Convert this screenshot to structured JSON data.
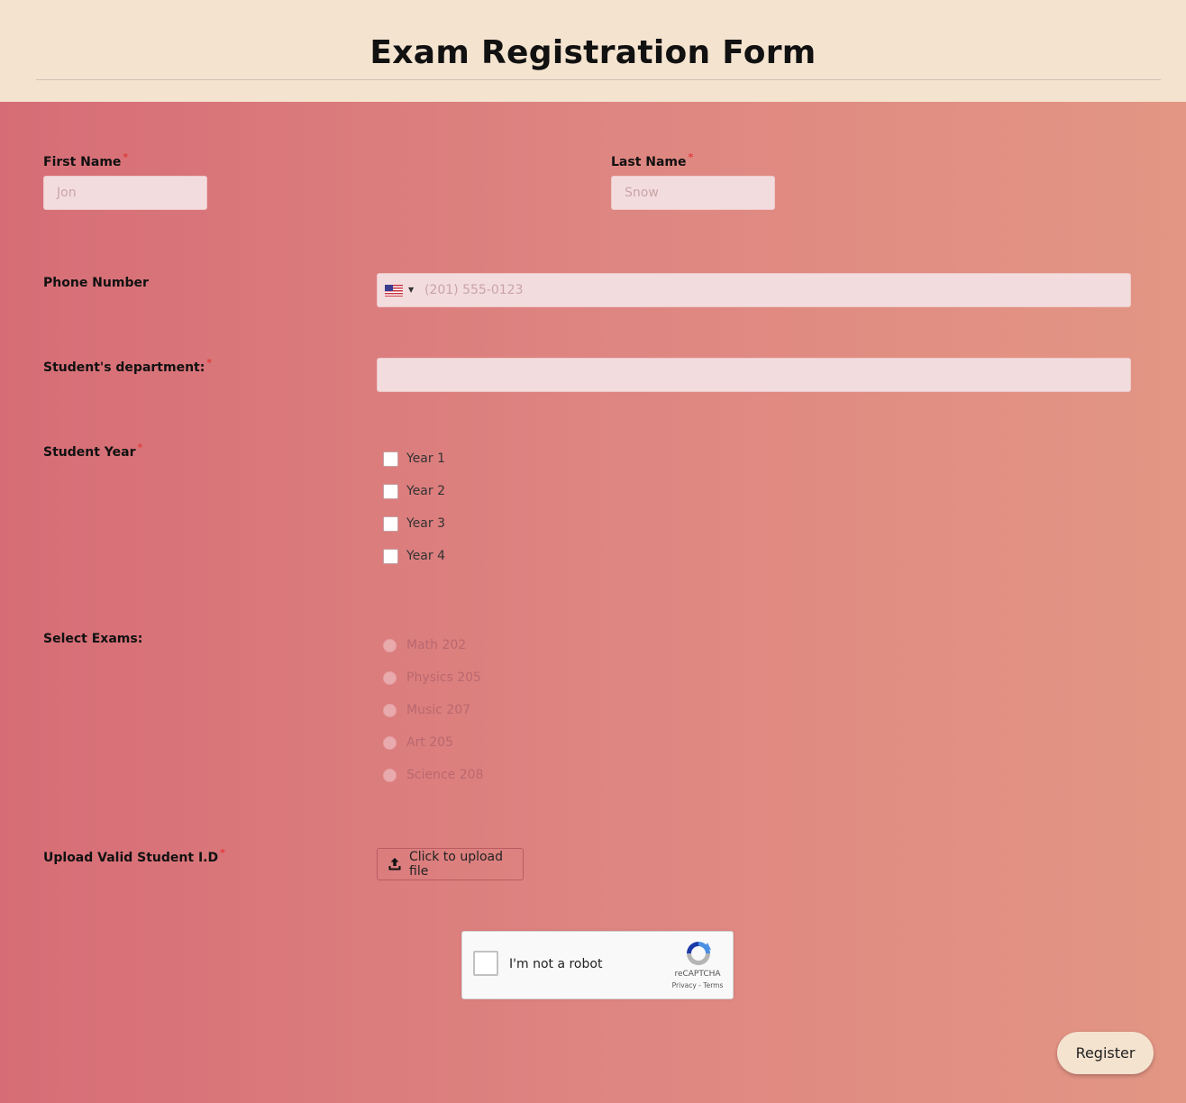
{
  "page": {
    "title": "Exam Registration Form"
  },
  "fields": {
    "first_name": {
      "label": "First Name",
      "required_mark": "*",
      "placeholder": "Jon"
    },
    "last_name": {
      "label": "Last Name",
      "required_mark": "*",
      "placeholder": "Snow"
    },
    "phone": {
      "label": "Phone Number",
      "country": "US",
      "caret": "▼",
      "placeholder": "(201) 555-0123"
    },
    "department": {
      "label": "Student's department:",
      "required_mark": "*",
      "value": ""
    },
    "student_year": {
      "label": "Student Year",
      "required_mark": "*",
      "options": [
        "Year 1",
        "Year 2",
        "Year 3",
        "Year 4"
      ]
    },
    "exams": {
      "label": "Select Exams:",
      "options": [
        "Math 202",
        "Physics 205",
        "Music 207",
        "Art 205",
        "Science 208"
      ]
    },
    "upload": {
      "label": "Upload Valid Student I.D",
      "required_mark": "*",
      "button_label": "Click to upload file",
      "icon": "upload-icon"
    }
  },
  "captcha": {
    "text": "I'm not a robot",
    "brand": "reCAPTCHA",
    "links": "Privacy - Terms"
  },
  "submit": {
    "label": "Register"
  },
  "colors": {
    "header_bg": "#f4e3cf",
    "gradient_start": "#d66d76",
    "gradient_end": "#e39684",
    "required": "#e23b3b"
  }
}
